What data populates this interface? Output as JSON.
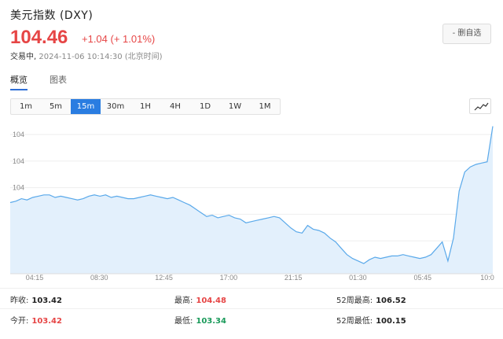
{
  "header": {
    "title": "美元指数 (DXY)",
    "price": "104.46",
    "change": "+1.04 (+ 1.01%)",
    "status": "交易中,",
    "timestamp": "2024-11-06 10:14:30 (北京时间)",
    "watch_label": "- 删自选"
  },
  "tabs": [
    {
      "label": "概览",
      "active": true
    },
    {
      "label": "图表",
      "active": false
    }
  ],
  "periods": [
    {
      "label": "1m",
      "active": false
    },
    {
      "label": "5m",
      "active": false
    },
    {
      "label": "15m",
      "active": true
    },
    {
      "label": "30m",
      "active": false
    },
    {
      "label": "1H",
      "active": false
    },
    {
      "label": "4H",
      "active": false
    },
    {
      "label": "1D",
      "active": false
    },
    {
      "label": "1W",
      "active": false
    },
    {
      "label": "1M",
      "active": false
    }
  ],
  "chart_toggle_icon": "line-chart-icon",
  "colors": {
    "up": "#e64545",
    "down": "#1a9a5a",
    "accent": "#2a7de1",
    "line": "#5aa9ea",
    "fill": "#e3f0fc"
  },
  "chart_data": {
    "type": "area",
    "y_tick_labels": [
      "104",
      "104",
      "104",
      "104",
      "104",
      "103"
    ],
    "x_tick_labels": [
      "04:15",
      "08:30",
      "12:45",
      "17:00",
      "21:15",
      "01:30",
      "05:45",
      "10:0"
    ],
    "ylim": [
      103.3,
      104.5
    ],
    "grid": true,
    "values": [
      103.86,
      103.87,
      103.89,
      103.88,
      103.9,
      103.91,
      103.92,
      103.92,
      103.9,
      103.91,
      103.9,
      103.89,
      103.88,
      103.89,
      103.91,
      103.92,
      103.91,
      103.92,
      103.9,
      103.91,
      103.9,
      103.89,
      103.89,
      103.9,
      103.91,
      103.92,
      103.91,
      103.9,
      103.89,
      103.9,
      103.88,
      103.86,
      103.84,
      103.81,
      103.78,
      103.75,
      103.76,
      103.74,
      103.75,
      103.76,
      103.74,
      103.73,
      103.7,
      103.71,
      103.72,
      103.73,
      103.74,
      103.75,
      103.74,
      103.7,
      103.66,
      103.63,
      103.62,
      103.68,
      103.65,
      103.64,
      103.62,
      103.58,
      103.55,
      103.5,
      103.45,
      103.42,
      103.4,
      103.38,
      103.41,
      103.43,
      103.42,
      103.43,
      103.44,
      103.44,
      103.45,
      103.44,
      103.43,
      103.42,
      103.43,
      103.45,
      103.5,
      103.55,
      103.4,
      103.58,
      103.95,
      104.1,
      104.14,
      104.16,
      104.17,
      104.18,
      104.46
    ]
  },
  "stats": {
    "prev_close_label": "昨收:",
    "prev_close": "103.42",
    "high_label": "最高:",
    "high": "104.48",
    "high52_label": "52周最高:",
    "high52": "106.52",
    "open_label": "今开:",
    "open": "103.42",
    "low_label": "最低:",
    "low": "103.34",
    "low52_label": "52周最低:",
    "low52": "100.15"
  }
}
